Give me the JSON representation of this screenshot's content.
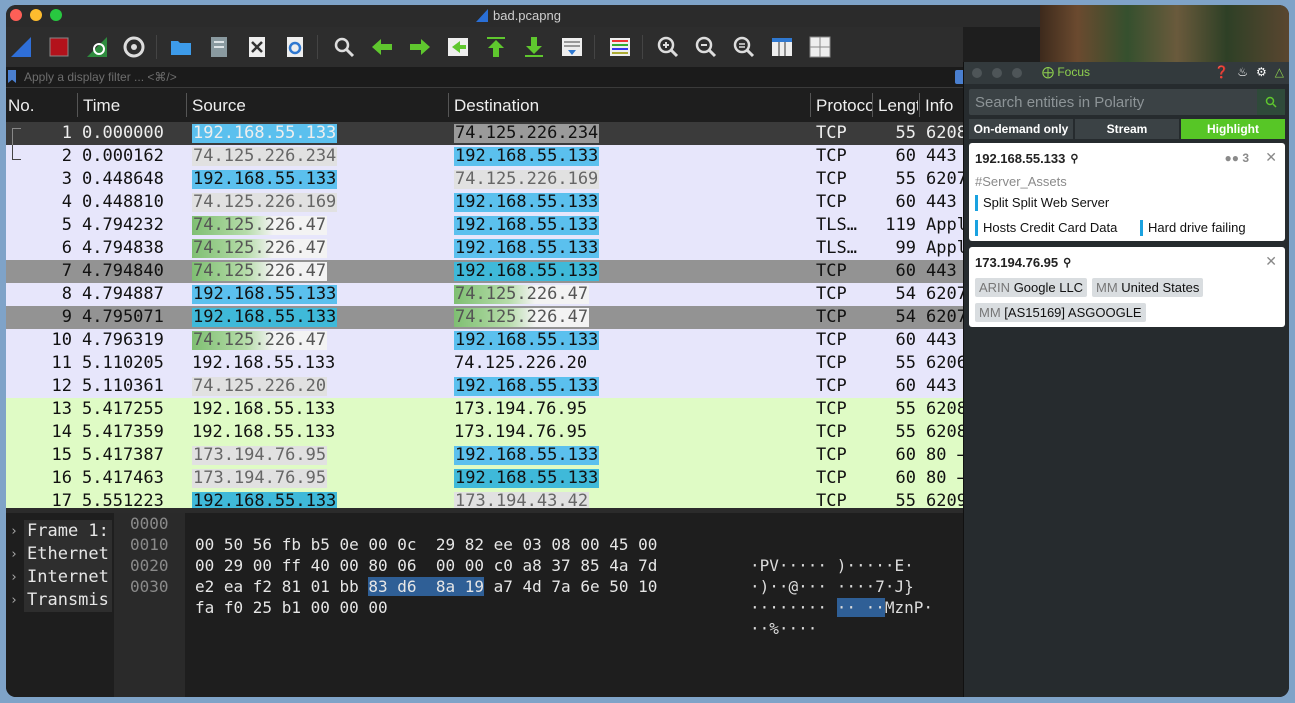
{
  "window": {
    "title": "bad.pcapng"
  },
  "filter": {
    "placeholder": "Apply a display filter ... <⌘/>"
  },
  "columns": {
    "no": "No.",
    "time": "Time",
    "source": "Source",
    "destination": "Destination",
    "protocol": "Protocol",
    "length": "Length",
    "info": "Info"
  },
  "packets": [
    {
      "no": "1",
      "time": "0.000000",
      "src": "192.168.55.133",
      "dst": "74.125.226.234",
      "proto": "TCP",
      "len": "55",
      "info": "6208"
    },
    {
      "no": "2",
      "time": "0.000162",
      "src": "74.125.226.234",
      "dst": "192.168.55.133",
      "proto": "TCP",
      "len": "60",
      "info": "443"
    },
    {
      "no": "3",
      "time": "0.448648",
      "src": "192.168.55.133",
      "dst": "74.125.226.169",
      "proto": "TCP",
      "len": "55",
      "info": "6207"
    },
    {
      "no": "4",
      "time": "0.448810",
      "src": "74.125.226.169",
      "dst": "192.168.55.133",
      "proto": "TCP",
      "len": "60",
      "info": "443"
    },
    {
      "no": "5",
      "time": "4.794232",
      "src": "74.125.226.47",
      "dst": "192.168.55.133",
      "proto": "TLS…",
      "len": "119",
      "info": "Appl"
    },
    {
      "no": "6",
      "time": "4.794838",
      "src": "74.125.226.47",
      "dst": "192.168.55.133",
      "proto": "TLS…",
      "len": "99",
      "info": "Appl"
    },
    {
      "no": "7",
      "time": "4.794840",
      "src": "74.125.226.47",
      "dst": "192.168.55.133",
      "proto": "TCP",
      "len": "60",
      "info": "443"
    },
    {
      "no": "8",
      "time": "4.794887",
      "src": "192.168.55.133",
      "dst": "74.125.226.47",
      "proto": "TCP",
      "len": "54",
      "info": "6207"
    },
    {
      "no": "9",
      "time": "4.795071",
      "src": "192.168.55.133",
      "dst": "74.125.226.47",
      "proto": "TCP",
      "len": "54",
      "info": "6207"
    },
    {
      "no": "10",
      "time": "4.796319",
      "src": "74.125.226.47",
      "dst": "192.168.55.133",
      "proto": "TCP",
      "len": "60",
      "info": "443"
    },
    {
      "no": "11",
      "time": "5.110205",
      "src": "192.168.55.133",
      "dst": "74.125.226.20",
      "proto": "TCP",
      "len": "55",
      "info": "6206"
    },
    {
      "no": "12",
      "time": "5.110361",
      "src": "74.125.226.20",
      "dst": "192.168.55.133",
      "proto": "TCP",
      "len": "60",
      "info": "443"
    },
    {
      "no": "13",
      "time": "5.417255",
      "src": "192.168.55.133",
      "dst": "173.194.76.95",
      "proto": "TCP",
      "len": "55",
      "info": "6208"
    },
    {
      "no": "14",
      "time": "5.417359",
      "src": "192.168.55.133",
      "dst": "173.194.76.95",
      "proto": "TCP",
      "len": "55",
      "info": "6208"
    },
    {
      "no": "15",
      "time": "5.417387",
      "src": "173.194.76.95",
      "dst": "192.168.55.133",
      "proto": "TCP",
      "len": "60",
      "info": "80 →"
    },
    {
      "no": "16",
      "time": "5.417463",
      "src": "173.194.76.95",
      "dst": "192.168.55.133",
      "proto": "TCP",
      "len": "60",
      "info": "80 →"
    },
    {
      "no": "17",
      "time": "5.551223",
      "src": "192.168.55.133",
      "dst": "173.194.43.42",
      "proto": "TCP",
      "len": "55",
      "info": "6209"
    }
  ],
  "tree": [
    "Frame 1:",
    "Ethernet",
    "Internet",
    "Transmis"
  ],
  "hex": {
    "offsets": [
      "0000",
      "0010",
      "0020",
      "0030"
    ],
    "r0": {
      "a": "00 50 56 fb b5 0e 00 0c  29 82 ee 03 08 00 45 00",
      "ascii": "·PV····· )·····E·"
    },
    "r1": {
      "a": "00 29 00 ff 40 00 80 06  00 00 c0 a8 37 85 4a 7d",
      "ascii": "·)··@··· ····7·J}"
    },
    "r2": {
      "pre": "e2 ea f2 81 01 bb ",
      "sel": "83 d6  8a 19",
      "post": " a7 4d 7a 6e 50 10",
      "ascii_pre": "········ ",
      "ascii_sel": "·· ··",
      "ascii_post": "MznP·"
    },
    "r3": {
      "a": "fa f0 25 b1 00 00 00",
      "ascii": "··%····"
    }
  },
  "polarity": {
    "focus_label": "Focus",
    "search_placeholder": "Search entities in Polarity",
    "tabs": [
      "On-demand only",
      "Stream",
      "Highlight"
    ],
    "card1": {
      "entity": "192.168.55.133",
      "user_count": "3",
      "tag": "#Server_Assets",
      "annotations": [
        "Split Split Web Server",
        "Hosts Credit Card Data",
        "Hard drive failing"
      ]
    },
    "card2": {
      "entity": "173.194.76.95",
      "chips": [
        {
          "key": "ARIN",
          "value": "Google LLC"
        },
        {
          "key": "MM",
          "value": "United States"
        },
        {
          "key": "MM",
          "value": "[AS15169] ASGOOGLE"
        }
      ]
    }
  }
}
